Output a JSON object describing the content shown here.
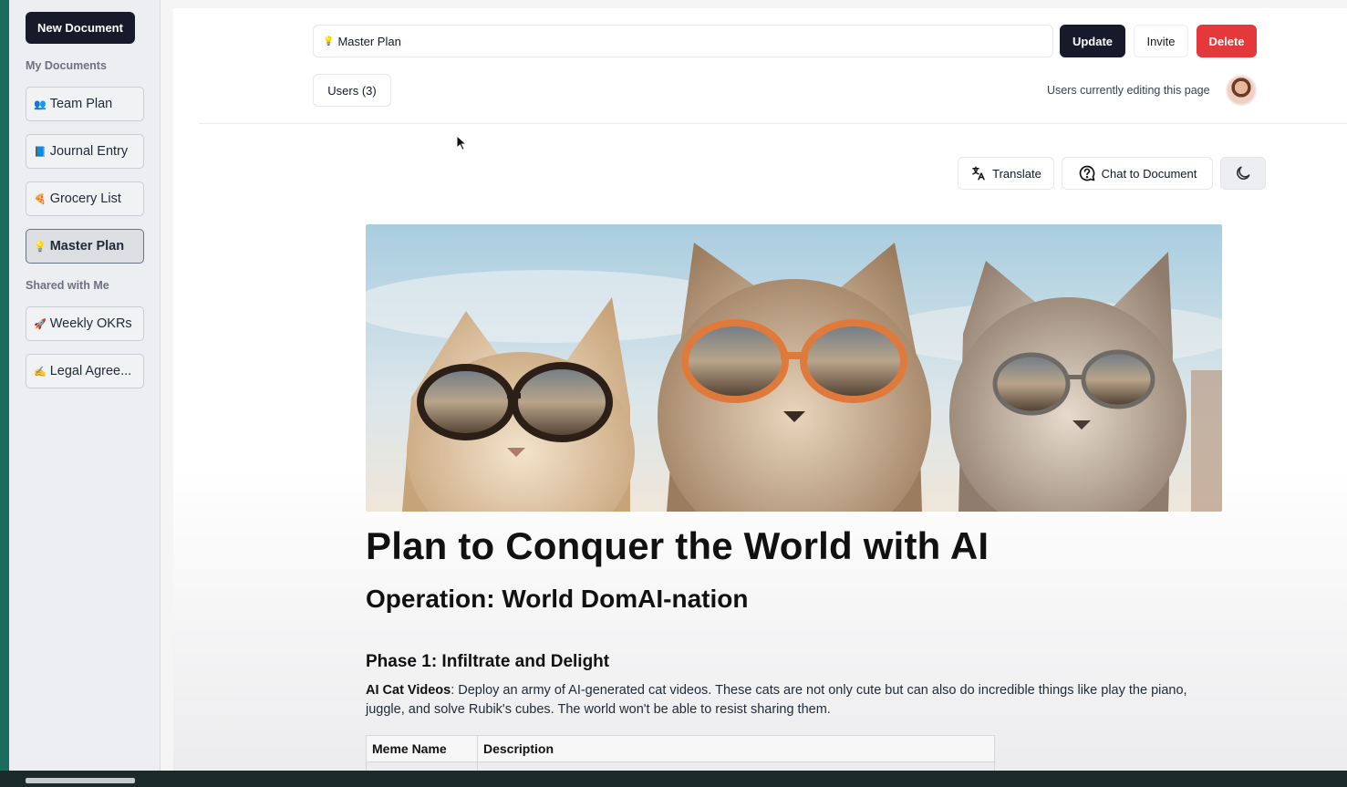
{
  "sidebar": {
    "new_document_label": "New Document",
    "my_documents_label": "My Documents",
    "shared_label": "Shared with Me",
    "my_documents": [
      {
        "emoji": "👥",
        "label": "Team Plan"
      },
      {
        "emoji": "📘",
        "label": "Journal Entry"
      },
      {
        "emoji": "🍕",
        "label": "Grocery List"
      },
      {
        "emoji": "💡",
        "label": "Master Plan"
      }
    ],
    "shared": [
      {
        "emoji": "🚀",
        "label": "Weekly OKRs"
      },
      {
        "emoji": "✍️",
        "label": "Legal Agree..."
      }
    ]
  },
  "header": {
    "title_emoji": "💡",
    "title_value": "Master Plan",
    "update_label": "Update",
    "invite_label": "Invite",
    "delete_label": "Delete",
    "users_label": "Users (3)",
    "editing_label": "Users currently editing this page"
  },
  "toolbar": {
    "translate_label": "Translate",
    "chat_label": "Chat to Document"
  },
  "document": {
    "title": "Plan to Conquer the World with AI",
    "subtitle": "Operation: World DomAI-nation",
    "phase1_heading": "Phase 1: Infiltrate and Delight",
    "phase1_bold": "AI Cat Videos",
    "phase1_text": ": Deploy an army of AI-generated cat videos. These cats are not only cute but can also do incredible things like play the piano, juggle, and solve Rubik's cubes. The world won't be able to resist sharing them.",
    "table_headers": [
      "Meme Name",
      "Description"
    ]
  },
  "colors": {
    "primary_dark": "#161a2b",
    "delete_red": "#e5383b"
  }
}
